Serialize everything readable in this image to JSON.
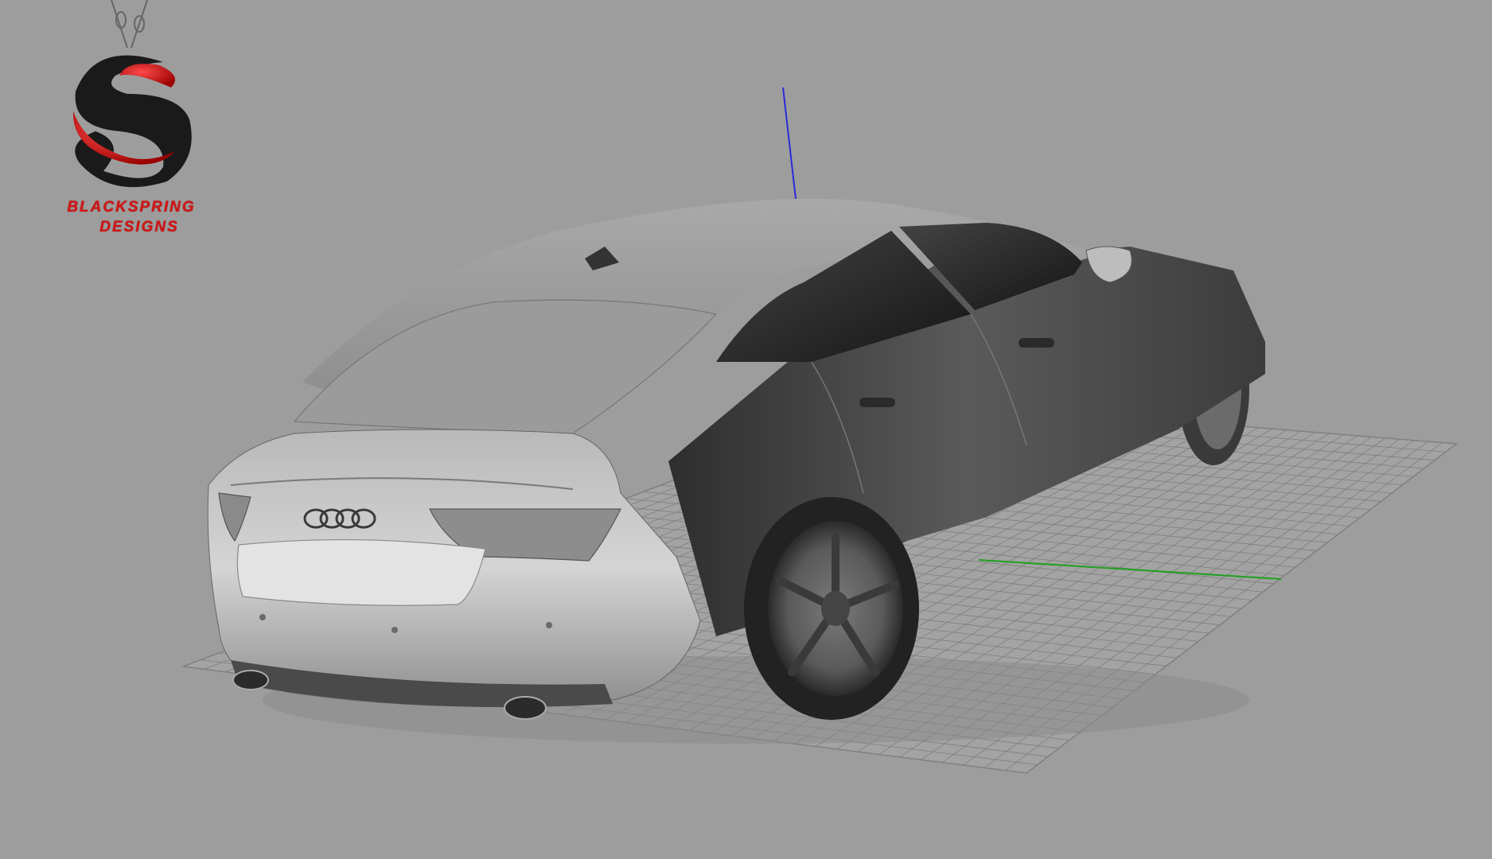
{
  "logo": {
    "line1": "BLACKSPRING",
    "line2": "DESIGNS",
    "icon": "s-swirl-pendant-icon",
    "colors": {
      "red": "#d21414",
      "black": "#1a1a1a"
    }
  },
  "viewport": {
    "background": "#9d9d9d",
    "axes": {
      "x_color": "#1fa01f",
      "z_color": "#2a2ad8"
    },
    "grid_color": "#7e7e7e"
  }
}
